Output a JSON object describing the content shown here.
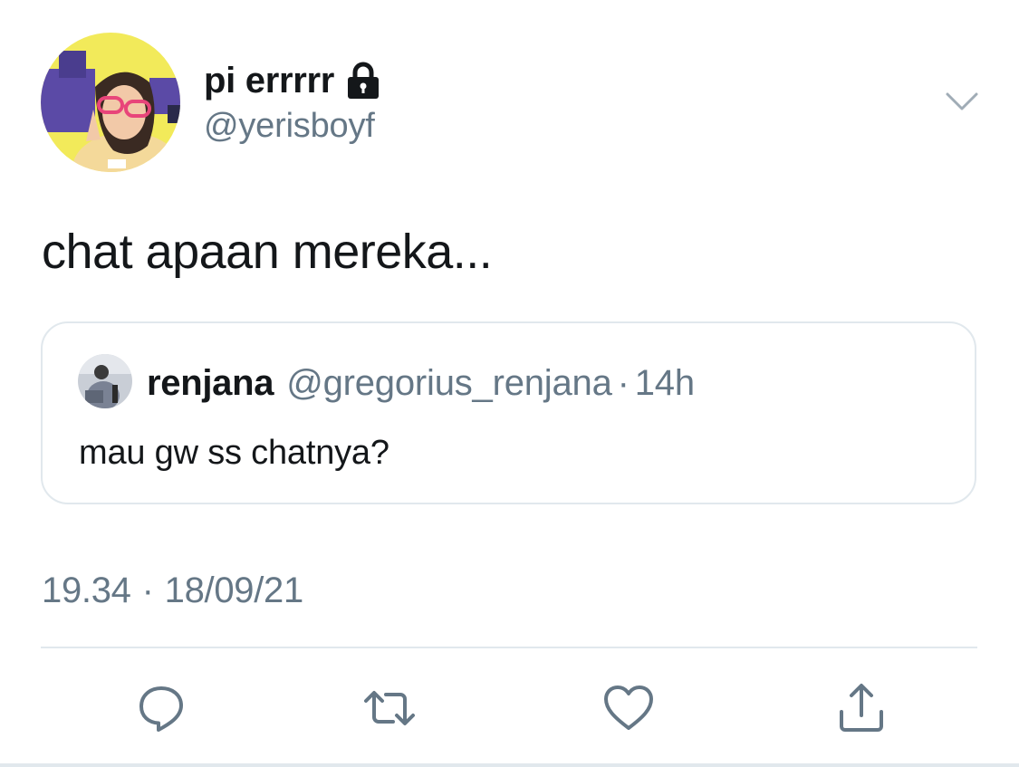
{
  "author": {
    "display_name": "pi errrrr",
    "handle": "@yerisboyf",
    "avatar": "profile-photo",
    "protected": true
  },
  "tweet": {
    "text": "chat apaan mereka...",
    "time": "19.34",
    "separator": "·",
    "date": "18/09/21"
  },
  "quoted_tweet": {
    "display_name": "renjana",
    "handle": "@gregorius_renjana",
    "separator": "·",
    "age": "14h",
    "text": "mau gw ss chatnya?",
    "avatar": "profile-photo"
  },
  "actions": [
    {
      "name": "reply",
      "icon": "reply-icon"
    },
    {
      "name": "retweet",
      "icon": "retweet-icon"
    },
    {
      "name": "like",
      "icon": "heart-icon"
    },
    {
      "name": "share",
      "icon": "share-icon"
    }
  ],
  "colors": {
    "text_primary": "#14171a",
    "text_secondary": "#657786",
    "border": "#e1e8ed",
    "icon": "#657786"
  }
}
